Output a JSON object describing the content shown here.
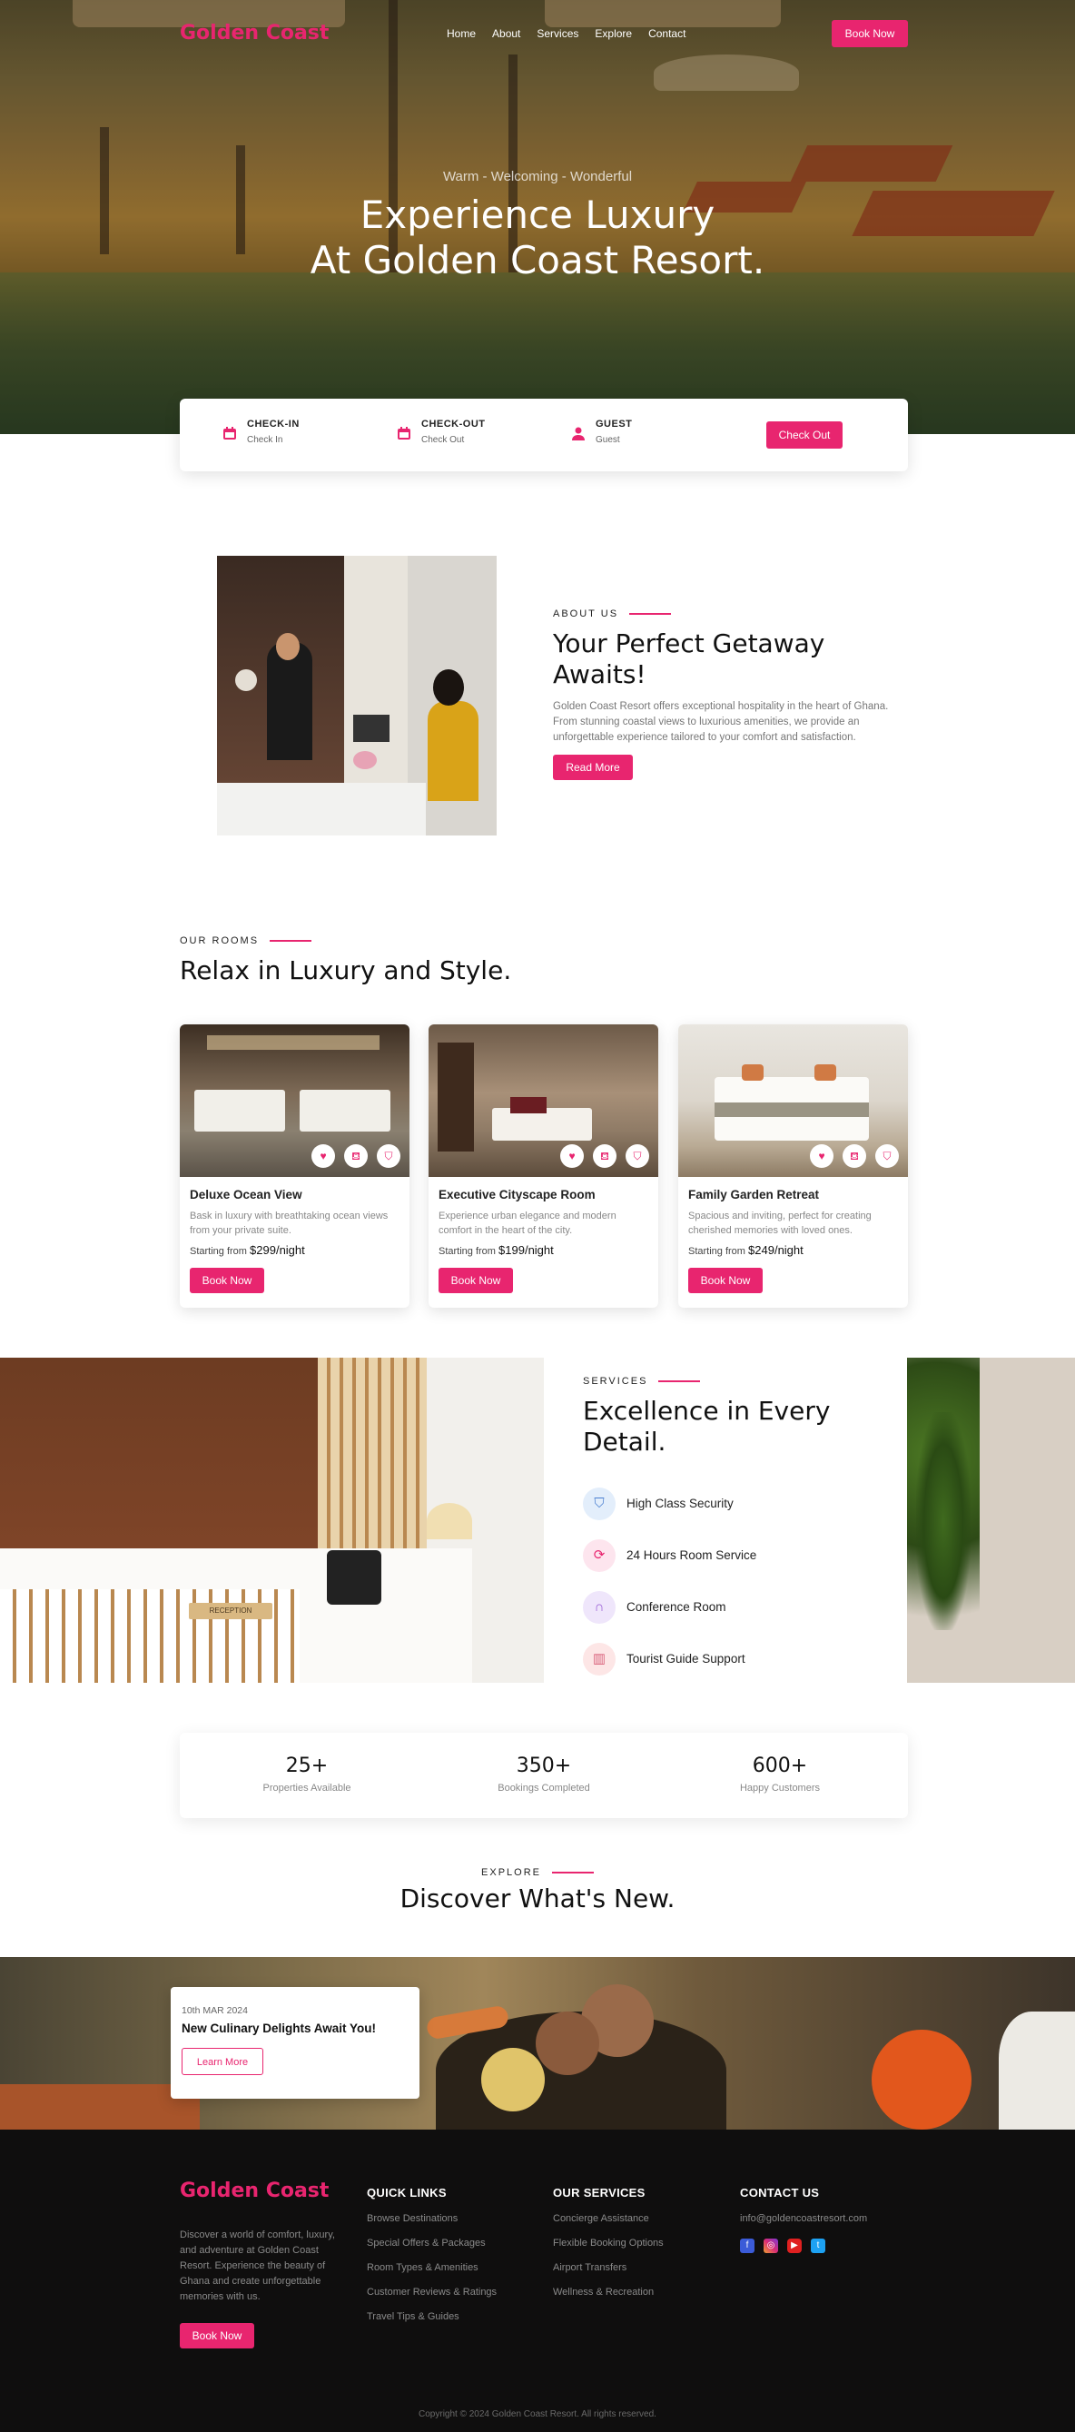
{
  "brand": "Golden Coast",
  "colors": {
    "accent": "#e8256f",
    "footer_bg": "#0f0e0e"
  },
  "header": {
    "nav": [
      "Home",
      "About",
      "Services",
      "Explore",
      "Contact"
    ],
    "book_now": "Book Now"
  },
  "hero": {
    "tagline": "Warm - Welcoming - Wonderful",
    "title_line1": "Experience Luxury",
    "title_line2": "At Golden Coast Resort."
  },
  "booking": {
    "checkin": {
      "title": "CHECK-IN",
      "value": "Check In",
      "icon": "calendar-icon"
    },
    "checkout": {
      "title": "CHECK-OUT",
      "value": "Check Out",
      "icon": "calendar-icon"
    },
    "guest": {
      "title": "GUEST",
      "value": "Guest",
      "icon": "user-icon"
    },
    "button": "Check Out"
  },
  "about": {
    "label": "ABOUT US",
    "title": "Your Perfect Getaway Awaits!",
    "text": "Golden Coast Resort offers exceptional hospitality in the heart of Ghana. From stunning coastal views to luxurious amenities, we provide an unforgettable experience tailored to your comfort and satisfaction.",
    "button": "Read More"
  },
  "rooms": {
    "label": "OUR ROOMS",
    "title": "Relax in Luxury and Style.",
    "starting_from": "Starting from",
    "items": [
      {
        "name": "Deluxe Ocean View",
        "desc": "Bask in luxury with breathtaking ocean views from your private suite.",
        "price": "$299/night",
        "button": "Book Now"
      },
      {
        "name": "Executive Cityscape Room",
        "desc": "Experience urban elegance and modern comfort in the heart of the city.",
        "price": "$199/night",
        "button": "Book Now"
      },
      {
        "name": "Family Garden Retreat",
        "desc": "Spacious and inviting, perfect for creating cherished memories with loved ones.",
        "price": "$249/night",
        "button": "Book Now"
      }
    ],
    "card_icons": [
      "heart-icon",
      "bucket-icon",
      "shield-icon"
    ]
  },
  "services": {
    "label": "SERVICES",
    "title": "Excellence in Every Detail.",
    "items": [
      {
        "label": "High Class Security",
        "icon": "shield-icon"
      },
      {
        "label": "24 Hours Room Service",
        "icon": "room-service-icon"
      },
      {
        "label": "Conference Room",
        "icon": "headphones-icon"
      },
      {
        "label": "Tourist Guide Support",
        "icon": "map-icon"
      }
    ],
    "reception_sign": "RECEPTION"
  },
  "stats": [
    {
      "number": "25+",
      "label": "Properties Available"
    },
    {
      "number": "350+",
      "label": "Bookings Completed"
    },
    {
      "number": "600+",
      "label": "Happy Customers"
    }
  ],
  "explore": {
    "label": "EXPLORE",
    "title": "Discover What's New.",
    "news": {
      "date": "10th MAR 2024",
      "title": "New Culinary Delights Await You!",
      "button": "Learn More"
    }
  },
  "footer": {
    "about": "Discover a world of comfort, luxury, and adventure at Golden Coast Resort. Experience the beauty of Ghana and create unforgettable memories with us.",
    "button": "Book Now",
    "quick_links": {
      "title": "QUICK LINKS",
      "items": [
        "Browse Destinations",
        "Special Offers & Packages",
        "Room Types & Amenities",
        "Customer Reviews & Ratings",
        "Travel Tips & Guides"
      ]
    },
    "services": {
      "title": "OUR SERVICES",
      "items": [
        "Concierge Assistance",
        "Flexible Booking Options",
        "Airport Transfers",
        "Wellness & Recreation"
      ]
    },
    "contact": {
      "title": "CONTACT US",
      "email": "info@goldencoastresort.com"
    },
    "social_icons": [
      "facebook-icon",
      "instagram-icon",
      "youtube-icon",
      "twitter-icon"
    ],
    "copyright": "Copyright © 2024 Golden Coast Resort. All rights reserved."
  }
}
